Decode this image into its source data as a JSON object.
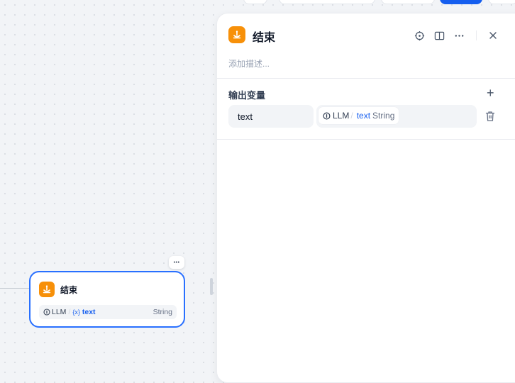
{
  "canvas": {
    "edge": "connection",
    "node": {
      "title": "结束",
      "menu_label": "•••",
      "variable": {
        "source": "LLM",
        "separator": "/",
        "var_marker": "{x}",
        "name": "text",
        "type": "String"
      }
    }
  },
  "panel": {
    "title": "结束",
    "description_placeholder": "添加描述...",
    "tools": [
      "locate-icon",
      "book-icon",
      "more-icon",
      "close-icon"
    ],
    "output_section": {
      "title": "输出变量",
      "add_label": "+",
      "rows": [
        {
          "name": "text",
          "ref_source": "LLM",
          "ref_separator": "/",
          "ref_name": "text",
          "ref_type": "String"
        }
      ]
    }
  },
  "colors": {
    "accent": "#155eef",
    "node_icon": "#f79009",
    "selected_border": "#2970ff"
  }
}
